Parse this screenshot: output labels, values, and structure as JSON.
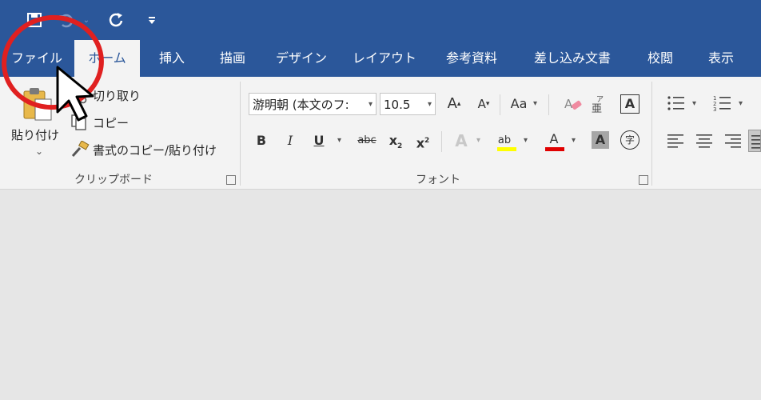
{
  "tabs": [
    {
      "label": "ファイル"
    },
    {
      "label": "ホーム"
    },
    {
      "label": "挿入"
    },
    {
      "label": "描画"
    },
    {
      "label": "デザイン"
    },
    {
      "label": "レイアウト"
    },
    {
      "label": "参考資料"
    },
    {
      "label": "差し込み文書"
    },
    {
      "label": "校閲"
    },
    {
      "label": "表示"
    }
  ],
  "clipboard": {
    "paste_label": "貼り付け",
    "cut_label": "切り取り",
    "copy_label": "コピー",
    "format_painter_label": "書式のコピー/貼り付け",
    "group_label": "クリップボード"
  },
  "font": {
    "font_name": "游明朝 (本文のフ:",
    "font_size": "10.5",
    "grow_label": "A",
    "shrink_label": "A",
    "case_label": "Aa",
    "bold_label": "B",
    "italic_label": "I",
    "underline_label": "U",
    "strike_label": "abc",
    "subscript_label": "x",
    "superscript_label": "x",
    "effects_label": "A",
    "highlight_label": "ab",
    "color_label": "A",
    "shading_label": "A",
    "enclosed_label": "字",
    "border_label": "A",
    "group_label": "フォント"
  },
  "colors": {
    "ribbon_blue": "#2b579a",
    "annotation_red": "#e02020",
    "highlight_yellow": "#ffff00",
    "font_red": "#e00000"
  }
}
